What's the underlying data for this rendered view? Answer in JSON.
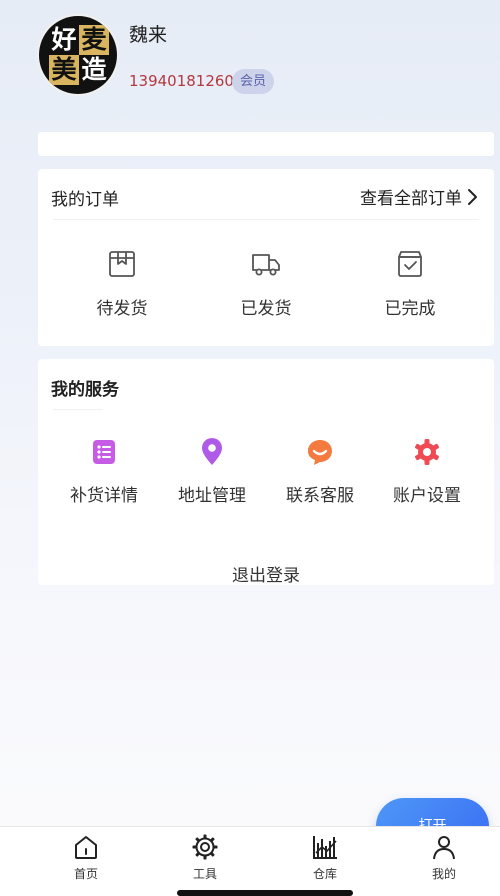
{
  "profile": {
    "avatar_chars": [
      "好",
      "麦",
      "美",
      "造"
    ],
    "name": "魏来",
    "phone": "13940181260",
    "badge": "会员"
  },
  "orders": {
    "title": "我的订单",
    "view_all": "查看全部订单",
    "items": [
      {
        "label": "待发货",
        "icon": "package-icon"
      },
      {
        "label": "已发货",
        "icon": "truck-icon"
      },
      {
        "label": "已完成",
        "icon": "bag-check-icon"
      }
    ]
  },
  "services": {
    "title": "我的服务",
    "items": [
      {
        "label": "补货详情",
        "icon": "list-icon",
        "color": "#c45ce6"
      },
      {
        "label": "地址管理",
        "icon": "location-pin-icon",
        "color": "#b05ae8"
      },
      {
        "label": "联系客服",
        "icon": "customer-service-icon",
        "color": "#f47a3e"
      },
      {
        "label": "账户设置",
        "icon": "gear-icon",
        "color": "#ef4b55"
      }
    ]
  },
  "logout": "退出登录",
  "open_button": "打开",
  "tabs": [
    {
      "label": "首页",
      "icon": "home-icon"
    },
    {
      "label": "工具",
      "icon": "gear-icon"
    },
    {
      "label": "仓库",
      "icon": "warehouse-chart-icon"
    },
    {
      "label": "我的",
      "icon": "person-icon"
    }
  ],
  "colors": {
    "phone": "#b3383e",
    "badge_bg": "#cdd3ea",
    "open_button": "#3f7cf5"
  }
}
